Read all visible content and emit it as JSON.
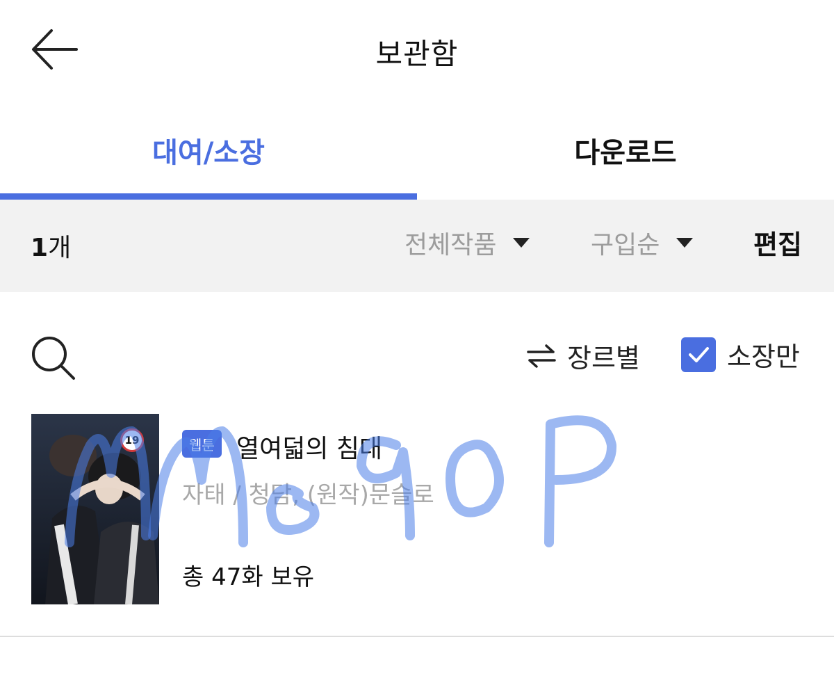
{
  "header": {
    "title": "보관함",
    "back_icon": "arrow-left-icon"
  },
  "tabs": [
    {
      "label": "대여/소장",
      "active": true
    },
    {
      "label": "다운로드",
      "active": false
    }
  ],
  "filter_bar": {
    "count_number": "1",
    "count_unit": "개",
    "category_filter": "전체작품",
    "sort_filter": "구입순",
    "edit_label": "편집"
  },
  "toolbar": {
    "search_icon": "search-icon",
    "genre_label": "장르별",
    "genre_icon": "swap-arrows-icon",
    "owned_only_label": "소장만",
    "owned_only_checked": true
  },
  "items": [
    {
      "type_badge": "웹툰",
      "title": "열여덟의 침대",
      "authors": "자태 / 청담, (원작)문슬로",
      "episodes": "총 47화 보유",
      "age_rating": "19"
    }
  ],
  "watermark_text": "mme9oP",
  "colors": {
    "accent": "#4a6ee0",
    "muted": "#9c9c9c",
    "filter_bg": "#f2f2f2"
  }
}
